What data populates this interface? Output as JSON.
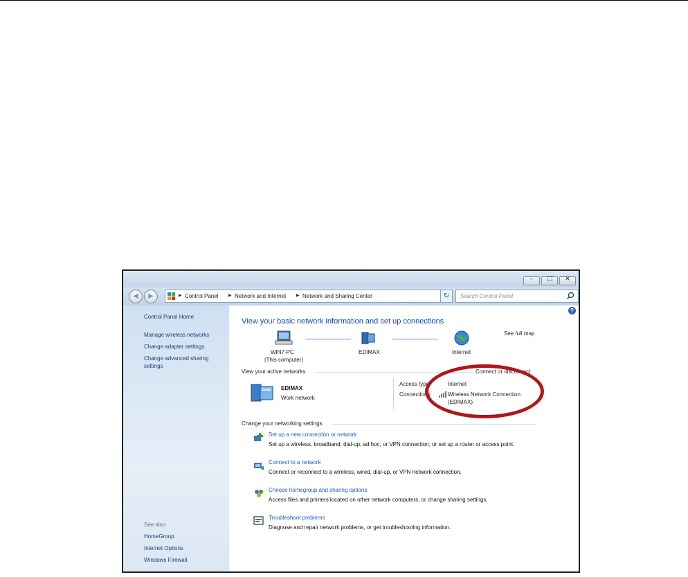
{
  "window": {
    "caption_buttons": [
      {
        "name": "minimize",
        "glyph": "–"
      },
      {
        "name": "maximize",
        "glyph": "□"
      },
      {
        "name": "close",
        "glyph": "✕"
      }
    ]
  },
  "breadcrumb": [
    "Control Panel",
    "Network and Internet",
    "Network and Sharing Center"
  ],
  "search": {
    "placeholder": "Search Control Panel"
  },
  "sidebar": {
    "home": "Control Panel Home",
    "items": [
      "Manage wireless networks",
      "Change adapter settings",
      "Change advanced sharing",
      "settings"
    ],
    "see_also_label": "See also",
    "see_also": [
      "HomeGroup",
      "Internet Options",
      "Windows Firewall"
    ]
  },
  "main": {
    "heading": "View your basic network information and set up connections",
    "see_full_map": "See full map",
    "map": {
      "computer_name": "WIN7-PC",
      "computer_sub": "(This computer)",
      "network_name": "EDIMAX",
      "internet_label": "Internet"
    },
    "active_networks_label": "View your active networks",
    "connect_disconnect": "Connect or disconnect",
    "active_network": {
      "name": "EDIMAX",
      "type": "Work network",
      "access_type_label": "Access type:",
      "access_type_value": "Internet",
      "connections_label": "Connections:",
      "connection_name": "Wireless Network Connection",
      "connection_sub": "(EDIMAX)"
    },
    "change_settings_label": "Change your networking settings",
    "tasks": [
      {
        "title": "Set up a new connection or network",
        "desc": "Set up a wireless, broadband, dial-up, ad hoc, or VPN connection; or set up a router or access point."
      },
      {
        "title": "Connect to a network",
        "desc": "Connect or reconnect to a wireless, wired, dial-up, or VPN network connection."
      },
      {
        "title": "Choose homegroup and sharing options",
        "desc": "Access files and printers located on other network computers, or change sharing settings."
      },
      {
        "title": "Troubleshoot problems",
        "desc": "Diagnose and repair network problems, or get troubleshooting information."
      }
    ]
  },
  "colors": {
    "link": "#1b5cc8",
    "heading": "#1b4aa3",
    "highlight": "#b0161a"
  }
}
